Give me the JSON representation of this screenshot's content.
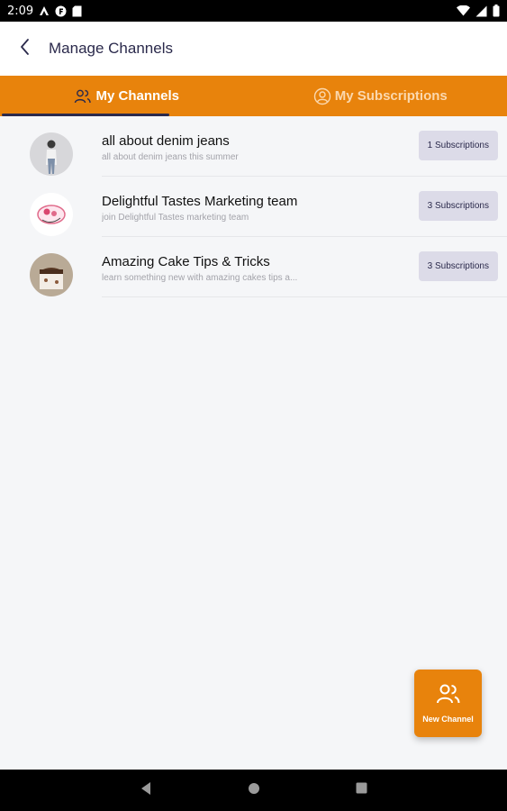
{
  "status_bar": {
    "time": "2:09",
    "left_icons": [
      "android-studio-icon",
      "f-app-icon",
      "sd-card-icon"
    ],
    "right_icons": [
      "wifi-icon",
      "signal-icon",
      "battery-icon"
    ]
  },
  "header": {
    "title": "Manage Channels",
    "back_icon": "chevron-left-icon"
  },
  "tabs": [
    {
      "label": "My Channels",
      "icon": "users-icon",
      "active": true
    },
    {
      "label": "My Subscriptions",
      "icon": "user-circle-icon",
      "active": false
    }
  ],
  "channels": [
    {
      "title": "all about denim jeans",
      "subtitle": "all about denim jeans this summer",
      "badge": "1 Subscriptions",
      "avatar": "denim-avatar"
    },
    {
      "title": "Delightful Tastes Marketing team",
      "subtitle": "join Delightful Tastes marketing team",
      "badge": "3 Subscriptions",
      "avatar": "logo-avatar"
    },
    {
      "title": "Amazing Cake Tips & Tricks",
      "subtitle": "learn something new with amazing cakes tips a...",
      "badge": "3 Subscriptions",
      "avatar": "cake-avatar"
    }
  ],
  "fab": {
    "label": "New Channel",
    "icon": "users-icon"
  },
  "colors": {
    "accent": "#e8830c",
    "navy": "#2b2a4c",
    "badge_bg": "#dcdbe8",
    "background": "#f5f6f8"
  },
  "nav": {
    "icons": [
      "back-triangle-icon",
      "home-circle-icon",
      "recents-square-icon"
    ]
  }
}
